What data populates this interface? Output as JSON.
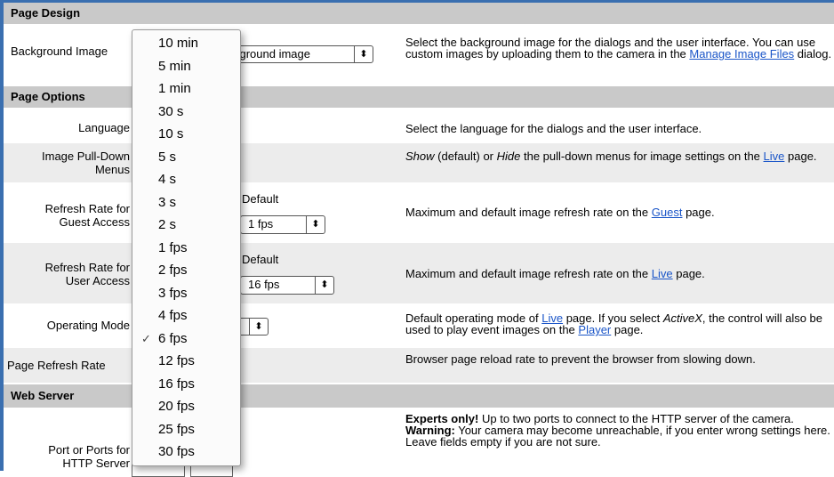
{
  "sections": {
    "page_design": "Page Design",
    "page_options": "Page Options",
    "web_server": "Web Server"
  },
  "rows": {
    "background_image": {
      "label": "Background Image",
      "select_value": "kground image",
      "desc_1": "Select the background image for the dialogs and the user interface. You can use custom images by uploading them to the camera in the ",
      "desc_link": "Manage Image Files",
      "desc_2": " dialog."
    },
    "language": {
      "label": "Language",
      "desc": "Select the language for the dialogs and the user interface."
    },
    "image_pulldown": {
      "label_1": "Image Pull-Down",
      "label_2": "Menus",
      "desc_show": "Show",
      "desc_1": " (default) or ",
      "desc_hide": "Hide",
      "desc_2": " the pull-down menus for image settings on the ",
      "desc_link": "Live",
      "desc_3": " page."
    },
    "refresh_guest": {
      "label_1": "Refresh Rate for",
      "label_2": "Guest Access",
      "default_header": "Default",
      "default_value": "1 fps",
      "desc_1": "Maximum and default image refresh rate on the ",
      "desc_link": "Guest",
      "desc_2": " page."
    },
    "refresh_user": {
      "label_1": "Refresh Rate for",
      "label_2": "User Access",
      "default_header": "Default",
      "default_value": "16 fps",
      "desc_1": "Maximum and default image refresh rate on the ",
      "desc_link": "Live",
      "desc_2": " page."
    },
    "operating_mode": {
      "label": "Operating Mode",
      "desc_1": "Default operating mode of ",
      "desc_link": "Live",
      "desc_2": " page. If you select ",
      "desc_activex": "ActiveX",
      "desc_3": ", the control will also be used to play event images on the ",
      "desc_link2": "Player",
      "desc_4": " page."
    },
    "page_refresh": {
      "label": "Page Refresh Rate",
      "desc": "Browser page reload rate to prevent the browser from slowing down."
    },
    "http_ports": {
      "label_1": "Port or Ports for",
      "label_2": "HTTP Server",
      "desc_experts": "Experts only!",
      "desc_1": " Up to two ports to connect to the HTTP server of the camera.",
      "desc_warning": "Warning:",
      "desc_2": " Your camera may become unreachable, if you enter wrong settings here. Leave fields empty if you are not sure."
    }
  },
  "select_arrows": "⬍",
  "dropdown": {
    "selected_index": 13,
    "check": "✓",
    "options": [
      "10 min",
      "5 min",
      "1 min",
      "30 s",
      "10 s",
      "5 s",
      "4 s",
      "3 s",
      "2 s",
      "1 fps",
      "2 fps",
      "3 fps",
      "4 fps",
      "6 fps",
      "12 fps",
      "16 fps",
      "20 fps",
      "25 fps",
      "30 fps"
    ]
  }
}
